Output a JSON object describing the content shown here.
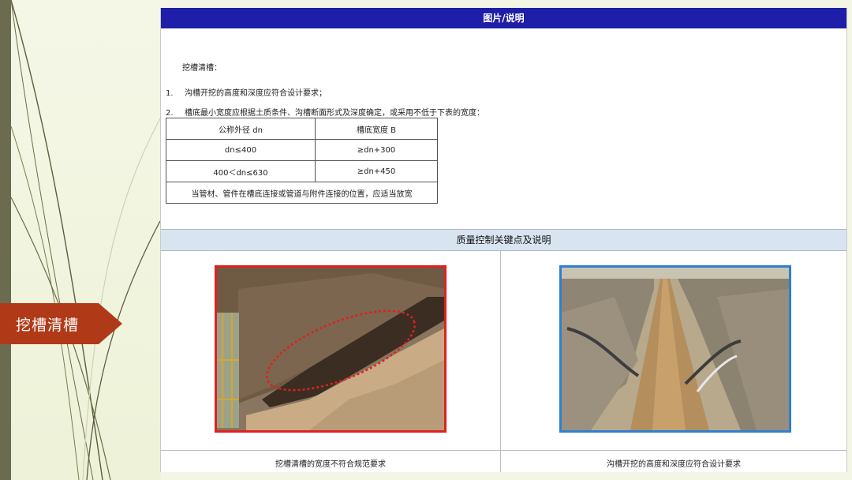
{
  "section_tag": {
    "label": "挖槽清槽",
    "color": "#b03a17"
  },
  "document": {
    "header": "图片/说明",
    "intro": "挖槽清槽：",
    "items": [
      {
        "num": "1.",
        "text": "沟槽开挖的高度和深度应符合设计要求；"
      },
      {
        "num": "2.",
        "text": "槽底最小宽度应根据土质条件、沟槽断面形式及深度确定，或采用不低于下表的宽度："
      }
    ],
    "table": {
      "headers": [
        "公称外径 dn",
        "槽底宽度 B"
      ],
      "rows": [
        [
          "dn≤400",
          "≥dn+300"
        ],
        [
          "400＜dn≤630",
          "≥dn+450"
        ]
      ],
      "note": "当管材、管件在槽底连接或管道与附件连接的位置，应适当放宽"
    },
    "quality_header": "质量控制关键点及说明",
    "photos": [
      {
        "caption": "挖槽清槽的宽度不符合规范要求",
        "border_color": "#e0201e"
      },
      {
        "caption": "沟槽开挖的高度和深度应符合设计要求",
        "border_color": "#2e7fd1"
      }
    ]
  }
}
